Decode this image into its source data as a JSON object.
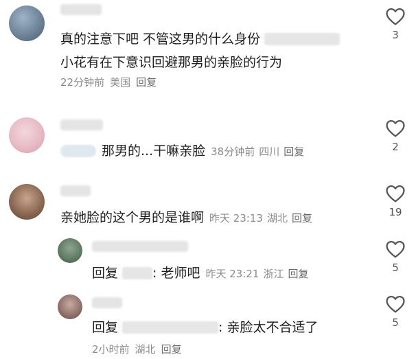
{
  "colors": {
    "text": "#1f1f1f",
    "meta": "#8a8a8a",
    "heart": "#555555"
  },
  "comments": [
    {
      "text_line1": "真的注意下吧  不管这男的什么身份",
      "text_line2": "小花有在下意识回避那男的亲脸的行为",
      "time": "22分钟前",
      "location": "美国",
      "reply_label": "回复",
      "likes": "3"
    },
    {
      "text": "那男的...干嘛亲脸",
      "time": "38分钟前",
      "location": "四川",
      "reply_label": "回复",
      "likes": "2"
    },
    {
      "text": "亲她脸的这个男的是谁啊",
      "time": "昨天 23:13",
      "location": "湖北",
      "reply_label": "回复",
      "likes": "19"
    }
  ],
  "replies": [
    {
      "prefix": "回复",
      "text": ": 老师吧",
      "time": "昨天 23:21",
      "location": "浙江",
      "reply_label": "回复",
      "likes": "5"
    },
    {
      "prefix": "回复",
      "text": ": 亲脸太不合适了",
      "time": "2小时前",
      "location": "湖北",
      "reply_label": "回复",
      "likes": "5"
    }
  ],
  "icons": {
    "like": "heart-outline-icon"
  }
}
